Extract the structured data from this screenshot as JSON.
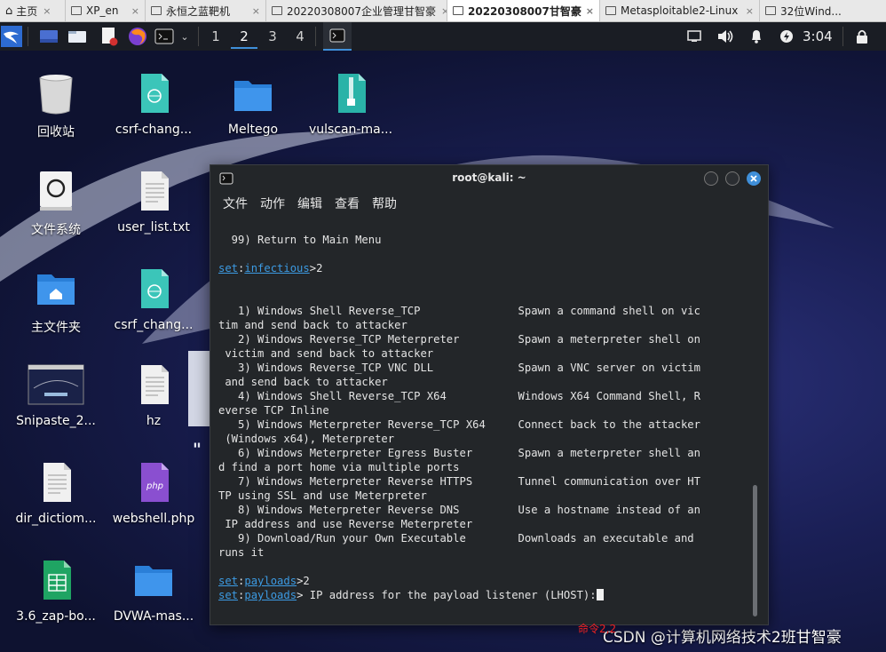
{
  "tabs": [
    {
      "label": "主页",
      "icon": "home-icon"
    },
    {
      "label": "XP_en",
      "icon": "vm-icon"
    },
    {
      "label": "永恒之蓝靶机",
      "icon": "vm-icon"
    },
    {
      "label": "20220308007企业管理甘智豪",
      "icon": "vm-icon"
    },
    {
      "label": "20220308007甘智豪",
      "icon": "vm-icon",
      "active": true
    },
    {
      "label": "Metasploitable2-Linux",
      "icon": "vm-icon"
    },
    {
      "label": "32位Wind...",
      "icon": "vm-icon"
    }
  ],
  "panel": {
    "workspaces": [
      "1",
      "2",
      "3",
      "4"
    ],
    "active_workspace": "2",
    "clock": "3:04"
  },
  "desktop": {
    "icons": [
      {
        "label": "回收站",
        "icon": "trash-icon"
      },
      {
        "label": "csrf-chang...",
        "icon": "html-file-icon"
      },
      {
        "label": "Meltego",
        "icon": "folder-icon"
      },
      {
        "label": "vulscan-ma...",
        "icon": "zip-file-icon"
      },
      {
        "label": "文件系统",
        "icon": "filesystem-icon"
      },
      {
        "label": "user_list.txt",
        "icon": "text-file-icon"
      },
      {
        "label": "主文件夹",
        "icon": "home-folder-icon"
      },
      {
        "label": "csrf_chang...",
        "icon": "html-file-icon"
      },
      {
        "label": "Snipaste_2...",
        "icon": "image-file-icon"
      },
      {
        "label": "hz",
        "icon": "text-file-icon"
      },
      {
        "label": "dir_dictiom...",
        "icon": "text-file-icon"
      },
      {
        "label": "webshell.php",
        "icon": "php-file-icon"
      },
      {
        "label": "3.6_zap-bo...",
        "icon": "spreadsheet-file-icon"
      },
      {
        "label": "DVWA-mas...",
        "icon": "folder-icon"
      }
    ]
  },
  "terminal": {
    "title": "root@kali: ~",
    "menu": [
      "文件",
      "动作",
      "编辑",
      "查看",
      "帮助"
    ],
    "lines": [
      "  99) Return to Main Menu",
      "",
      "",
      "",
      "",
      "   1) Windows Shell Reverse_TCP               Spawn a command shell on vic",
      "tim and send back to attacker",
      "   2) Windows Reverse_TCP Meterpreter         Spawn a meterpreter shell on",
      " victim and send back to attacker",
      "   3) Windows Reverse_TCP VNC DLL             Spawn a VNC server on victim",
      " and send back to attacker",
      "   4) Windows Shell Reverse_TCP X64           Windows X64 Command Shell, R",
      "everse TCP Inline",
      "   5) Windows Meterpreter Reverse_TCP X64     Connect back to the attacker",
      " (Windows x64), Meterpreter",
      "   6) Windows Meterpreter Egress Buster       Spawn a meterpreter shell an",
      "d find a port home via multiple ports",
      "   7) Windows Meterpreter Reverse HTTPS       Tunnel communication over HT",
      "TP using SSL and use Meterpreter",
      "   8) Windows Meterpreter Reverse DNS         Use a hostname instead of an",
      " IP address and use Reverse Meterpreter",
      "   9) Download/Run your Own Executable        Downloads an executable and",
      "runs it"
    ],
    "prompt_infectious": {
      "set": "set",
      "module": "infectious",
      "input": ">2"
    },
    "prompt_payloads_1": {
      "set": "set",
      "module": "payloads",
      "input": ">2"
    },
    "prompt_payloads_2": {
      "set": "set",
      "module": "payloads",
      "input": "> IP address for the payload listener (LHOST):"
    },
    "annotation": "命令2,2"
  },
  "watermark": "CSDN @计算机网络技术2班甘智豪",
  "colors": {
    "accent": "#3c9be3",
    "terminal_bg": "#232629",
    "annotation": "#e22222",
    "close_button": "#3f8fd9"
  }
}
